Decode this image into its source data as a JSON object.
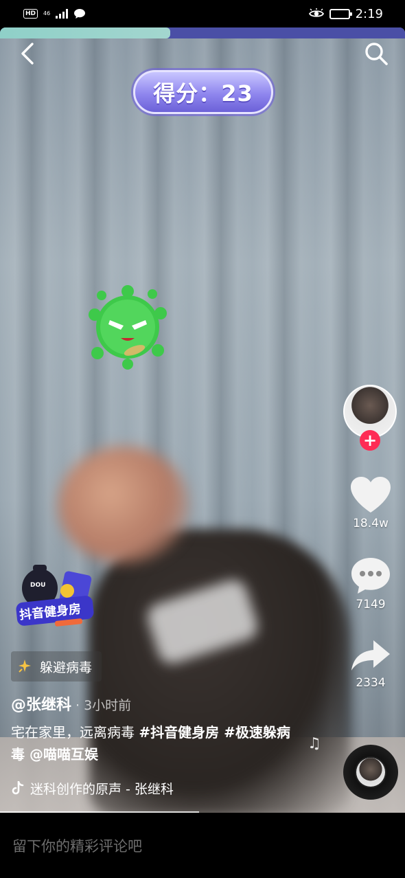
{
  "status_bar": {
    "hd": "HD",
    "network": "46",
    "time": "2:19"
  },
  "video": {
    "progress_fraction": 0.42,
    "score_label": "得分：23"
  },
  "rail": {
    "like_count": "18.4w",
    "comment_count": "7149",
    "share_count": "2334",
    "follow_symbol": "+"
  },
  "post": {
    "effect_name": "躲避病毒",
    "author": "@张继科",
    "time_ago": "· 3小时前",
    "caption_plain": "宅在家里，远离病毒 ",
    "caption_tag1": "#抖音健身房",
    "caption_tag2": " #极速躲病毒",
    "caption_mention": " @喵喵互娱",
    "music": "迷科创作的原声 - 张继科",
    "badge_text": "抖音健身房",
    "badge_small": "DOU"
  },
  "comment": {
    "placeholder": "留下你的精彩评论吧"
  },
  "colors": {
    "follow_red": "#fe2c55",
    "progress_bg": "#4a4fa6",
    "progress_fill": "#a3d6cf",
    "score_purple": "#8f86ee"
  }
}
